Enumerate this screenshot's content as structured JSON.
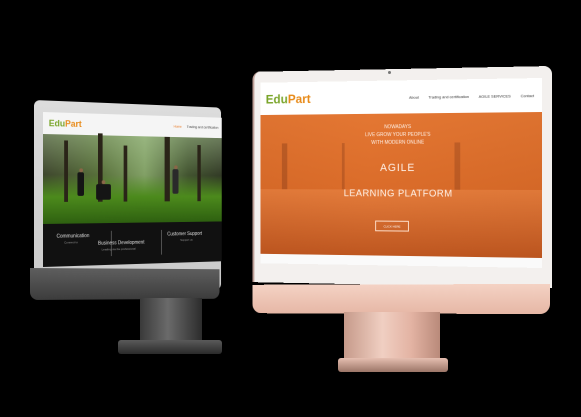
{
  "back_monitor": {
    "logo_main": "Edu",
    "logo_accent": "Part",
    "nav": [
      "Home",
      "Trading and certification"
    ],
    "columns": [
      {
        "title": "Communication",
        "sub": "Connect to"
      },
      {
        "title": "Business Development",
        "sub": "Leading via the professional"
      },
      {
        "title": "Customer Support",
        "sub": "Support us"
      }
    ]
  },
  "front_monitor": {
    "logo_main": "Edu",
    "logo_accent": "Part",
    "nav": [
      "About",
      "Trading and certification",
      "AGILE SERVICES",
      "Contact"
    ],
    "hero": {
      "line1": "NOWADAYS",
      "line2": "LIVE GROW YOUR PEOPLE'S",
      "line3": "WITH MODERN ONLINE",
      "headline": "AGILE",
      "subheadline": "LEARNING PLATFORM",
      "cta": "CLICK HERE"
    }
  },
  "colors": {
    "background": "#000000",
    "orange_hero": "#e2783c",
    "logo_green": "#7aa52a",
    "logo_orange": "#e88b1a",
    "rose_gold": "#efc6b8",
    "space_gray": "#3c3c3c"
  }
}
